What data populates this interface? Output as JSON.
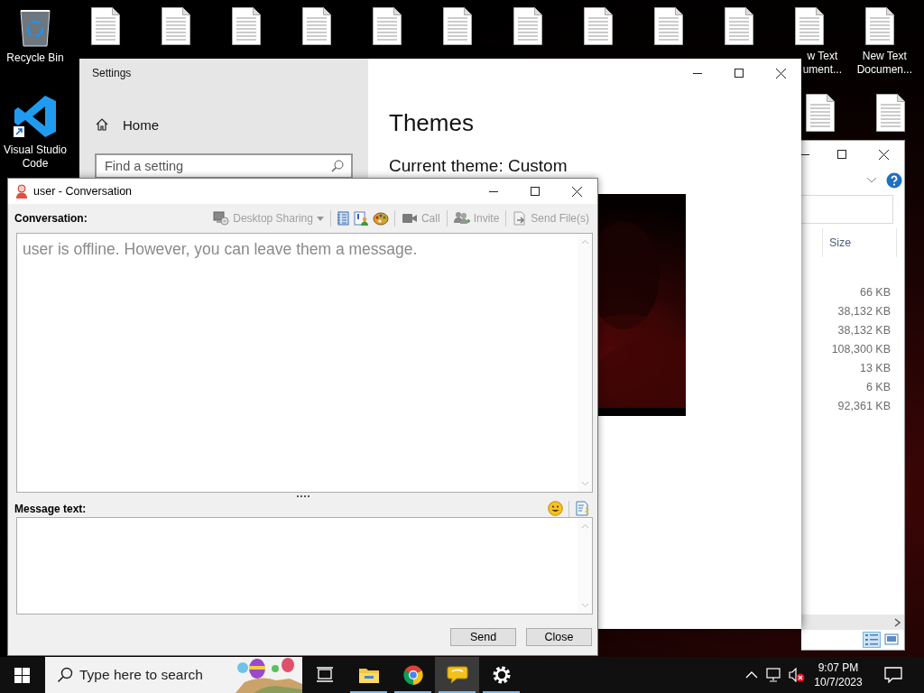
{
  "desktop": {
    "row_1": [
      {
        "kind": "recycle-bin",
        "label": [
          "Recycle Bin"
        ]
      },
      {
        "kind": "text-file"
      },
      {
        "kind": "text-file"
      },
      {
        "kind": "text-file"
      },
      {
        "kind": "text-file"
      },
      {
        "kind": "text-file"
      },
      {
        "kind": "text-file"
      },
      {
        "kind": "text-file"
      },
      {
        "kind": "text-file"
      },
      {
        "kind": "text-file"
      },
      {
        "kind": "text-file"
      },
      {
        "kind": "text-file",
        "label": [
          "w Text",
          "ument..."
        ]
      },
      {
        "kind": "text-file",
        "label": [
          "New Text",
          "Documen..."
        ]
      }
    ],
    "row_2_left": [
      {
        "kind": "code-editor",
        "label": [
          "Visual Studio",
          "Code"
        ]
      }
    ],
    "row_2_right": [
      {
        "kind": "text-file"
      },
      {
        "kind": "text-file"
      }
    ]
  },
  "explorer": {
    "column_header": "Size",
    "sizes": [
      "66 KB",
      "38,132 KB",
      "38,132 KB",
      "108,300 KB",
      "13 KB",
      "6 KB",
      "92,361 KB"
    ],
    "view_buttons": [
      {
        "kind": "details",
        "selected": true
      },
      {
        "kind": "thumbnails",
        "selected": false
      }
    ]
  },
  "settings": {
    "title": "Settings",
    "home": "Home",
    "search": {
      "placeholder": "Find a setting"
    },
    "heading": "Themes",
    "current_theme": "Current theme: Custom"
  },
  "conversation": {
    "title": "user - Conversation",
    "history_label": "Conversation:",
    "toolbar": [
      {
        "kind": "desktop-sharing",
        "label": "Desktop Sharing",
        "disabled": true
      },
      {
        "kind": "separator"
      },
      {
        "kind": "notes"
      },
      {
        "kind": "contact-info"
      },
      {
        "kind": "palette"
      },
      {
        "kind": "separator"
      },
      {
        "kind": "call",
        "label": "Call",
        "disabled": true
      },
      {
        "kind": "separator"
      },
      {
        "kind": "invite",
        "label": "Invite",
        "disabled": true
      },
      {
        "kind": "separator"
      },
      {
        "kind": "send-file",
        "label": "Send File(s)",
        "disabled": true
      }
    ],
    "status_message": "user is offline. However, you can leave them a message.",
    "message_label": "Message text:",
    "buttons": [
      "Send",
      "Close"
    ]
  },
  "taskbar": {
    "search": {
      "placeholder": "Type here to search"
    },
    "apps": [
      {
        "kind": "task-view",
        "running": false,
        "selected": false
      },
      {
        "kind": "file-explorer",
        "running": true,
        "selected": false
      },
      {
        "kind": "browser",
        "running": true,
        "selected": false
      },
      {
        "kind": "chat",
        "running": true,
        "selected": true
      },
      {
        "kind": "settings",
        "running": true,
        "selected": false
      }
    ],
    "tray": {
      "volume_muted": true
    },
    "clock": {
      "time": "9:07 PM",
      "date": "10/7/2023"
    }
  }
}
